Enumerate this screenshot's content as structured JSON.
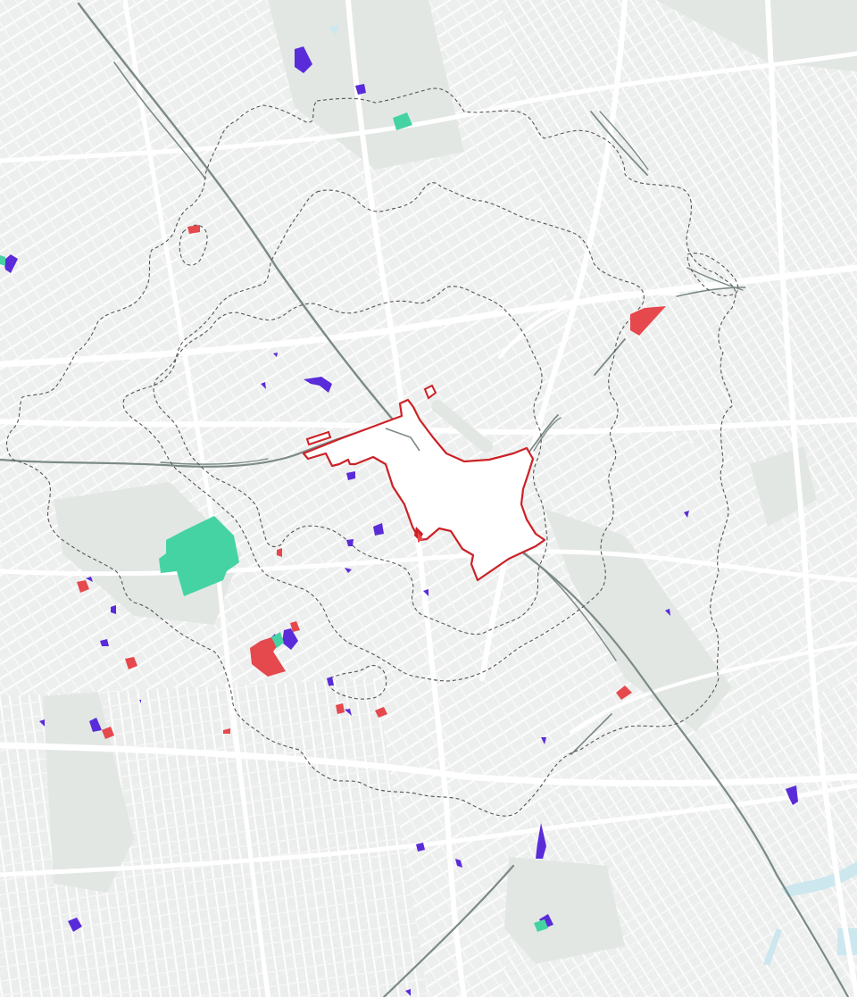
{
  "map": {
    "colors": {
      "background": "#f4f5f4",
      "road": "#ffffff",
      "block": "#e9ebea",
      "green_space": "#e2e7e4",
      "water": "#cde7ef",
      "railway": "#7b8a86",
      "site_boundary": "#cc2127",
      "catchment_contour": "#555555",
      "category_purple": "#5a2bd9",
      "category_red": "#e5484d",
      "category_green": "#45d3a4"
    },
    "legend_categories": [
      {
        "name": "purple-parcels",
        "color": "#5a2bd9"
      },
      {
        "name": "red-parcels",
        "color": "#e5484d"
      },
      {
        "name": "green-parcels",
        "color": "#45d3a4"
      }
    ],
    "features": {
      "site_boundary": "red-outline-site",
      "contour_lines": "dashed-catchment-lines",
      "railways": "railway-lines"
    },
    "text": []
  }
}
